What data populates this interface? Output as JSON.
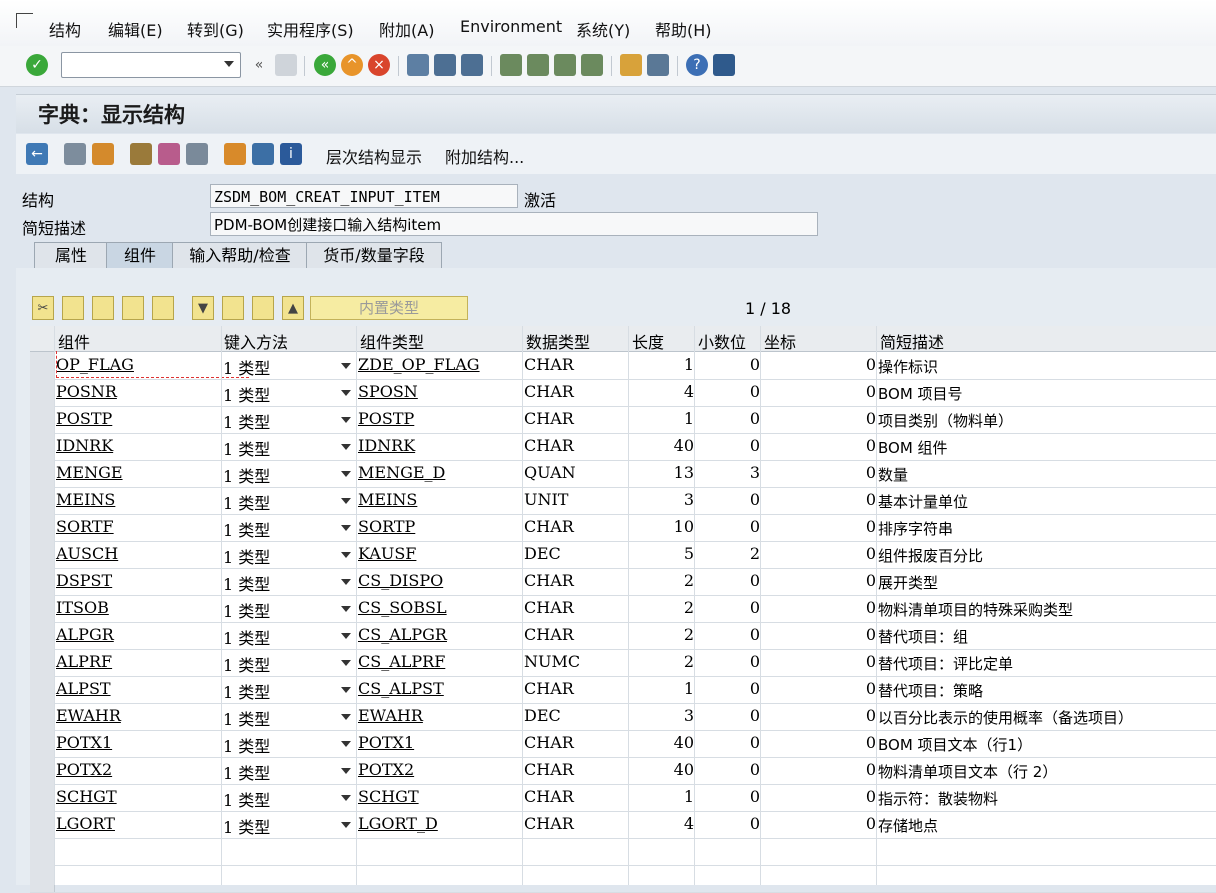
{
  "menu": [
    "结构",
    "编辑(E)",
    "转到(G)",
    "实用程序(S)",
    "附加(A)",
    "Environment",
    "系统(Y)",
    "帮助(H)"
  ],
  "title": "字典：显示结构",
  "toolbar2": {
    "hierarchy": "层次结构显示",
    "append": "附加结构..."
  },
  "fields": {
    "structure_label": "结构",
    "structure_value": "ZSDM_BOM_CREAT_INPUT_ITEM",
    "status": "激活",
    "desc_label": "简短描述",
    "desc_value": "PDM-BOM创建接口输入结构item"
  },
  "tabs": [
    "属性",
    "组件",
    "输入帮助/检查",
    "货币/数量字段"
  ],
  "builtin_type_label": "内置类型",
  "pager": "1 / 18",
  "columns": [
    "组件",
    "键入方法",
    "组件类型",
    "数据类型",
    "长度",
    "小数位",
    "坐标",
    "简短描述"
  ],
  "rows": [
    [
      "OP_FLAG",
      "1 类型",
      "ZDE_OP_FLAG",
      "CHAR",
      "1",
      "0",
      "0",
      "操作标识"
    ],
    [
      "POSNR",
      "1 类型",
      "SPOSN",
      "CHAR",
      "4",
      "0",
      "0",
      "BOM 项目号"
    ],
    [
      "POSTP",
      "1 类型",
      "POSTP",
      "CHAR",
      "1",
      "0",
      "0",
      "项目类别（物料单）"
    ],
    [
      "IDNRK",
      "1 类型",
      "IDNRK",
      "CHAR",
      "40",
      "0",
      "0",
      "BOM 组件"
    ],
    [
      "MENGE",
      "1 类型",
      "MENGE_D",
      "QUAN",
      "13",
      "3",
      "0",
      "数量"
    ],
    [
      "MEINS",
      "1 类型",
      "MEINS",
      "UNIT",
      "3",
      "0",
      "0",
      "基本计量单位"
    ],
    [
      "SORTF",
      "1 类型",
      "SORTP",
      "CHAR",
      "10",
      "0",
      "0",
      "排序字符串"
    ],
    [
      "AUSCH",
      "1 类型",
      "KAUSF",
      "DEC",
      "5",
      "2",
      "0",
      "组件报废百分比"
    ],
    [
      "DSPST",
      "1 类型",
      "CS_DISPO",
      "CHAR",
      "2",
      "0",
      "0",
      "展开类型"
    ],
    [
      "ITSOB",
      "1 类型",
      "CS_SOBSL",
      "CHAR",
      "2",
      "0",
      "0",
      "物料清单项目的特殊采购类型"
    ],
    [
      "ALPGR",
      "1 类型",
      "CS_ALPGR",
      "CHAR",
      "2",
      "0",
      "0",
      "替代项目：组"
    ],
    [
      "ALPRF",
      "1 类型",
      "CS_ALPRF",
      "NUMC",
      "2",
      "0",
      "0",
      "替代项目：评比定单"
    ],
    [
      "ALPST",
      "1 类型",
      "CS_ALPST",
      "CHAR",
      "1",
      "0",
      "0",
      "替代项目：策略"
    ],
    [
      "EWAHR",
      "1 类型",
      "EWAHR",
      "DEC",
      "3",
      "0",
      "0",
      "以百分比表示的使用概率（备选项目）"
    ],
    [
      "POTX1",
      "1 类型",
      "POTX1",
      "CHAR",
      "40",
      "0",
      "0",
      "BOM 项目文本（行1）"
    ],
    [
      "POTX2",
      "1 类型",
      "POTX2",
      "CHAR",
      "40",
      "0",
      "0",
      "物料清单项目文本（行 2）"
    ],
    [
      "SCHGT",
      "1 类型",
      "SCHGT",
      "CHAR",
      "1",
      "0",
      "0",
      "指示符：散装物料"
    ],
    [
      "LGORT",
      "1 类型",
      "LGORT_D",
      "CHAR",
      "4",
      "0",
      "0",
      "存储地点"
    ]
  ]
}
